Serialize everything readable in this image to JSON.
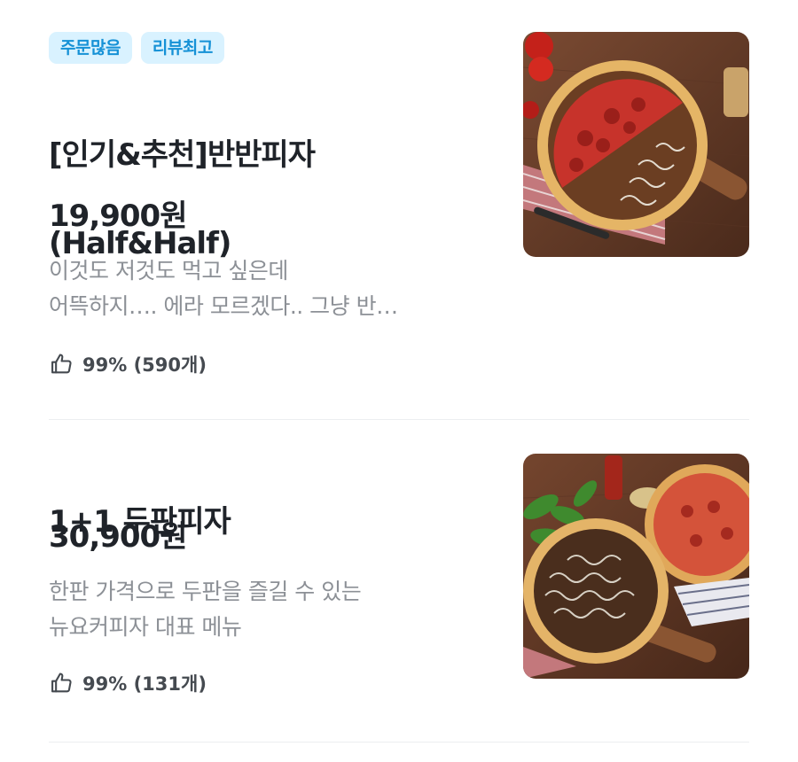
{
  "menu_items": [
    {
      "badges": [
        "주문많음",
        "리뷰최고"
      ],
      "title_line1": "[인기&추천]반반피자",
      "title_line2": "(Half&Half)",
      "price": "19,900원",
      "description_line1": "이것도 저것도 먹고 싶은데",
      "description_line2": "어뜩하지…. 에라 모르겠다.. 그냥 반…",
      "rating": "99% (590개)",
      "icon": "thumbs-up-icon",
      "image": "half-and-half-pizza-photo"
    },
    {
      "title_line1": "1+1 두판피자",
      "price": "30,900원",
      "description_line1": "한판 가격으로 두판을 즐길 수 있는",
      "description_line2": "뉴요커피자 대표 메뉴",
      "rating": "99% (131개)",
      "icon": "thumbs-up-icon",
      "image": "two-pizzas-photo"
    }
  ],
  "colors": {
    "badge_bg": "#d9f2ff",
    "badge_text": "#1591d6",
    "description": "#8c9096",
    "divider": "#eceef0"
  }
}
